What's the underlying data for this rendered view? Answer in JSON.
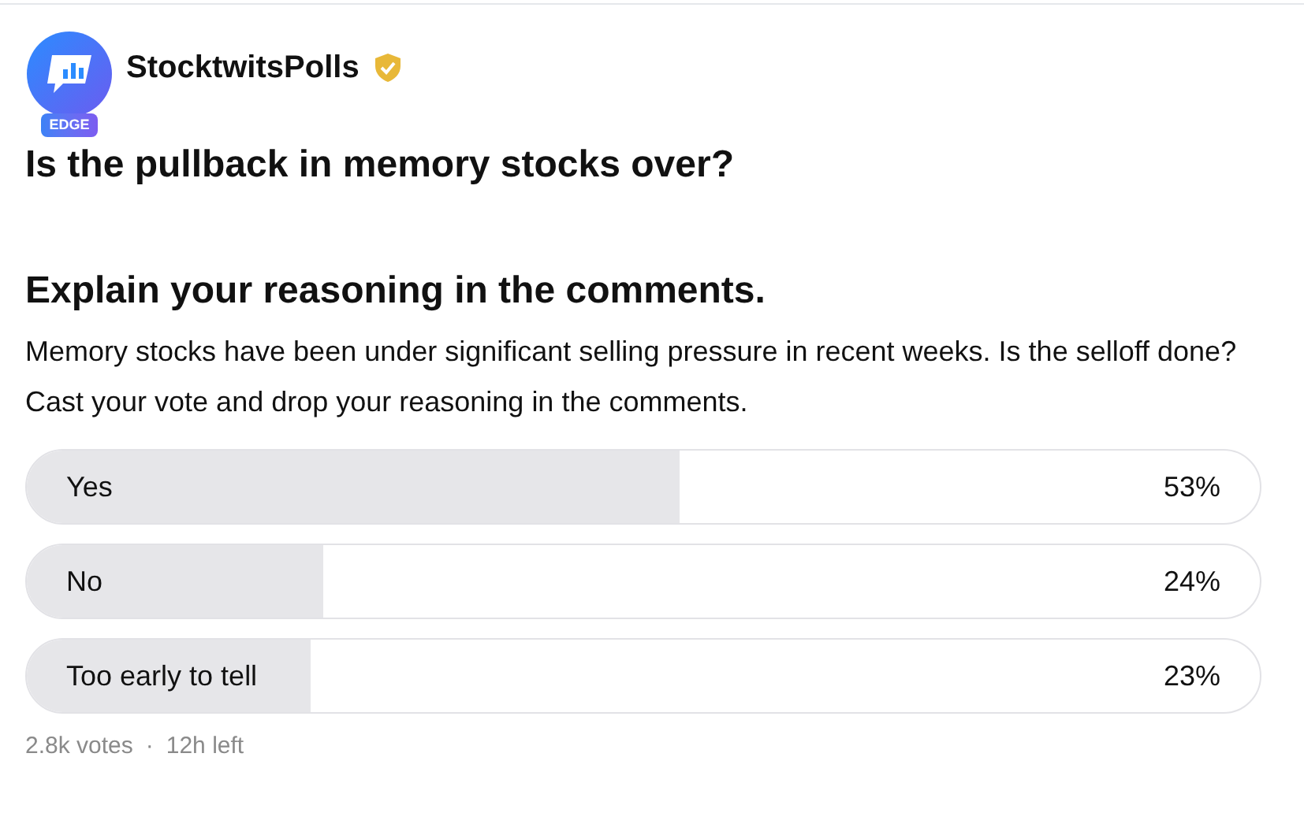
{
  "author": {
    "name": "StocktwitsPolls",
    "badge": "EDGE",
    "verified": true
  },
  "title_lines": [
    "Is the pullback in memory stocks over?",
    "Explain your reasoning in the comments."
  ],
  "description": "Memory stocks have been under significant selling pressure in recent weeks. Is the selloff done? Cast your vote and drop your reasoning in the comments.",
  "options": [
    {
      "label": "Yes",
      "percent": "53%",
      "level": 0.53
    },
    {
      "label": "No",
      "percent": "24%",
      "level": 0.24
    },
    {
      "label": "Too early to tell",
      "percent": "23%",
      "level": 0.23
    }
  ],
  "footer": {
    "votes": "2.8k votes",
    "separator": "·",
    "time_left": "12h left"
  }
}
